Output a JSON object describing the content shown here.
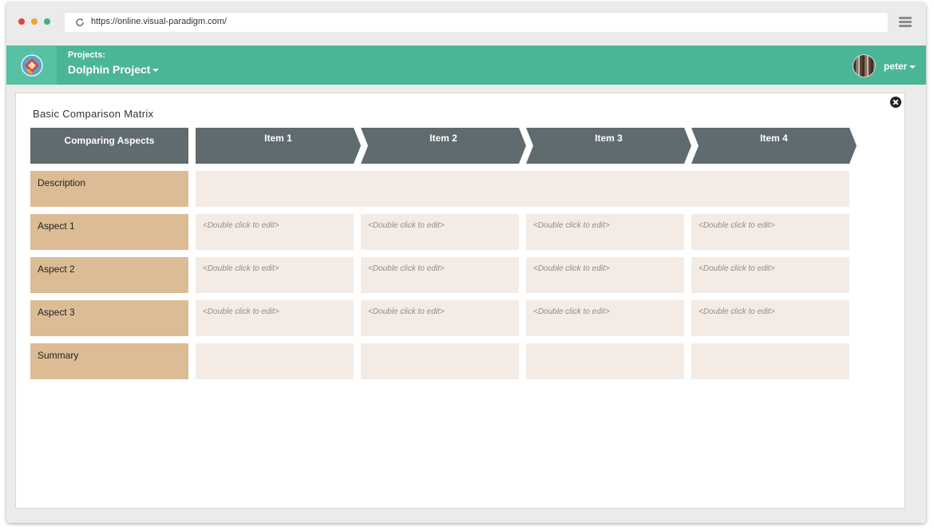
{
  "browser": {
    "url": "https://online.visual-paradigm.com/"
  },
  "appbar": {
    "projects_label": "Projects:",
    "project_name": "Dolphin Project",
    "user_name": "peter"
  },
  "matrix": {
    "title": "Basic Comparison Matrix",
    "aspect_header": "Comparing Aspects",
    "items": [
      "Item 1",
      "Item 2",
      "Item 3",
      "Item 4"
    ],
    "rows": [
      {
        "label": "Description",
        "cells": []
      },
      {
        "label": "Aspect 1",
        "cells": [
          "<Double click to edit>",
          "<Double click to edit>",
          "<Double click to edit>",
          "<Double click to edit>"
        ]
      },
      {
        "label": "Aspect 2",
        "cells": [
          "<Double click to edit>",
          "<Double click to edit>",
          "<Double click to edit>",
          "<Double click to edit>"
        ]
      },
      {
        "label": "Aspect 3",
        "cells": [
          "<Double click to edit>",
          "<Double click to edit>",
          "<Double click to edit>",
          "<Double click to edit>"
        ]
      },
      {
        "label": "Summary",
        "cells": [
          "",
          "",
          "",
          ""
        ]
      }
    ]
  },
  "colors": {
    "appbar": "#4bb597",
    "header_dark": "#5f6b6e",
    "row_label": "#dcbc95",
    "cell": "#f4ece4"
  }
}
